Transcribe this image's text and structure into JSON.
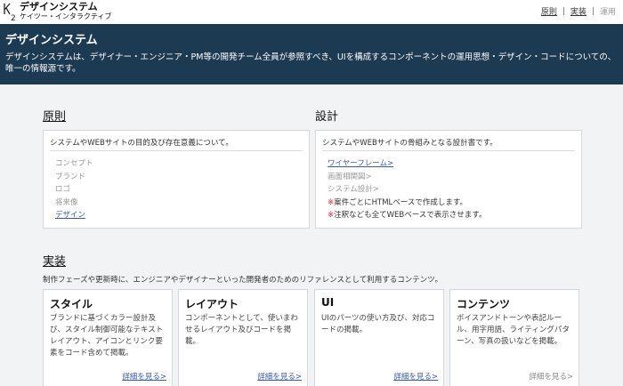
{
  "header": {
    "logo_title": "デザインシステム",
    "logo_sub": "ケイツー・インタラクティブ",
    "nav": [
      {
        "label": "原則",
        "active": true
      },
      {
        "label": "実装",
        "active": true
      },
      {
        "label": "運用",
        "active": false
      }
    ],
    "nav_sep": "|"
  },
  "hero": {
    "title": "デザインシステム",
    "description": "デザインシステムは、デザイナー・エンジニア・PM等の開発チーム全員が参照すべき、UIを構成するコンポーネントの運用思想・デザイン・コードについての、唯一の情報源です。"
  },
  "principles": {
    "title": "原則",
    "intro": "システムやWEBサイトの目的及び存在意義について。",
    "items": [
      "コンセプト",
      "ブランド",
      "ロゴ",
      "将来像"
    ],
    "link": "デザイン"
  },
  "design": {
    "title": "設計",
    "intro": "システムやWEBサイトの骨組みとなる設計書です。",
    "link": "ワイヤーフレーム>",
    "items": [
      "画面相関図>",
      "システム設計>"
    ],
    "notes": [
      "案件ごとにHTMLベースで作成します。",
      "注釈なども全てWEBベースで表示させます。"
    ],
    "note_mark": "※"
  },
  "implementation": {
    "title": "実装",
    "description": "制作フェーズや更新時に、エンジニアやデザイナーといった開発者のためのリファレンスとして利用するコンテンツ。",
    "cards": [
      {
        "title": "スタイル",
        "body": "ブランドに基づくカラー設計及び、スタイル制御可能なテキストレイアウト、アイコンとリンク要素をコード含めて掲載。",
        "more": "詳細を見る>"
      },
      {
        "title": "レイアウト",
        "body": "コンポーネントとして、使いまわせるレイアウト及びコードを掲載。",
        "more": "詳細を見る>"
      },
      {
        "title": "UI",
        "body": "UIのパーツの使い方及び、対応コードの掲載。",
        "more": "詳細を見る>"
      },
      {
        "title": "コンテンツ",
        "body": "ボイスアンドトーンや表記ルール、用字用語、ライティングパターン、写真の扱いなどを掲載。",
        "more": "詳細を見る>"
      }
    ]
  },
  "colors": {
    "hero_bg": "#1c3a52",
    "link": "#3b5aa8",
    "note_mark": "#dd2233"
  }
}
